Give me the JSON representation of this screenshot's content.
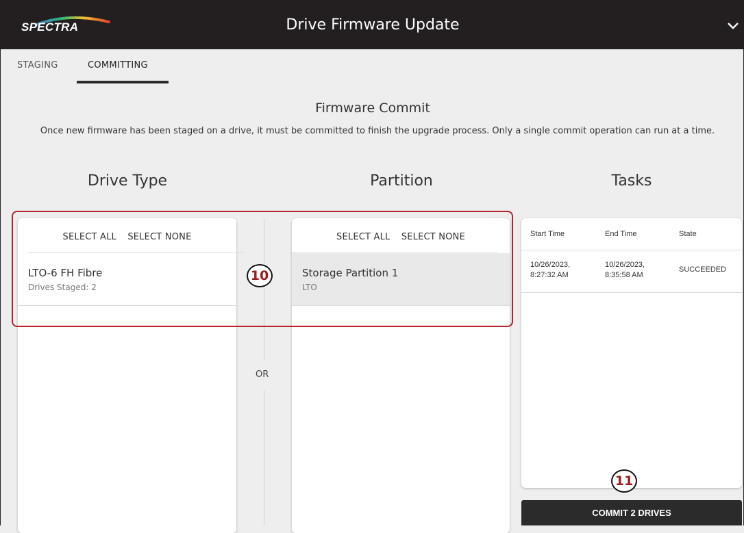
{
  "header": {
    "logo_text": "SPECTRA",
    "title": "Drive Firmware Update"
  },
  "tabs": [
    {
      "label": "STAGING",
      "active": false
    },
    {
      "label": "COMMITTING",
      "active": true
    }
  ],
  "section": {
    "title": "Firmware Commit",
    "description": "Once new firmware has been staged on a drive, it must be committed to finish the upgrade process. Only a single commit operation can run at a time."
  },
  "drive_type": {
    "heading": "Drive Type",
    "select_all": "SELECT ALL",
    "select_none": "SELECT NONE",
    "items": [
      {
        "title": "LTO-6 FH Fibre",
        "subtitle": "Drives Staged: 2"
      }
    ]
  },
  "separator": {
    "or_label": "OR"
  },
  "partition": {
    "heading": "Partition",
    "select_all": "SELECT ALL",
    "select_none": "SELECT NONE",
    "items": [
      {
        "title": "Storage Partition 1",
        "subtitle": "LTO",
        "selected": true
      }
    ]
  },
  "tasks": {
    "heading": "Tasks",
    "columns": [
      "Start Time",
      "End Time",
      "State"
    ],
    "rows": [
      {
        "start": "10/26/2023,\n8:27:32 AM",
        "end": "10/26/2023,\n8:35:58 AM",
        "state": "SUCCEEDED"
      }
    ]
  },
  "commit_button": "COMMIT 2 DRIVES",
  "callouts": [
    "10",
    "11"
  ],
  "colors": {
    "topbar": "#231f20",
    "highlight": "#b3262f",
    "callout_text": "#9b1b1b",
    "commit_button": "#2b2b2b"
  }
}
